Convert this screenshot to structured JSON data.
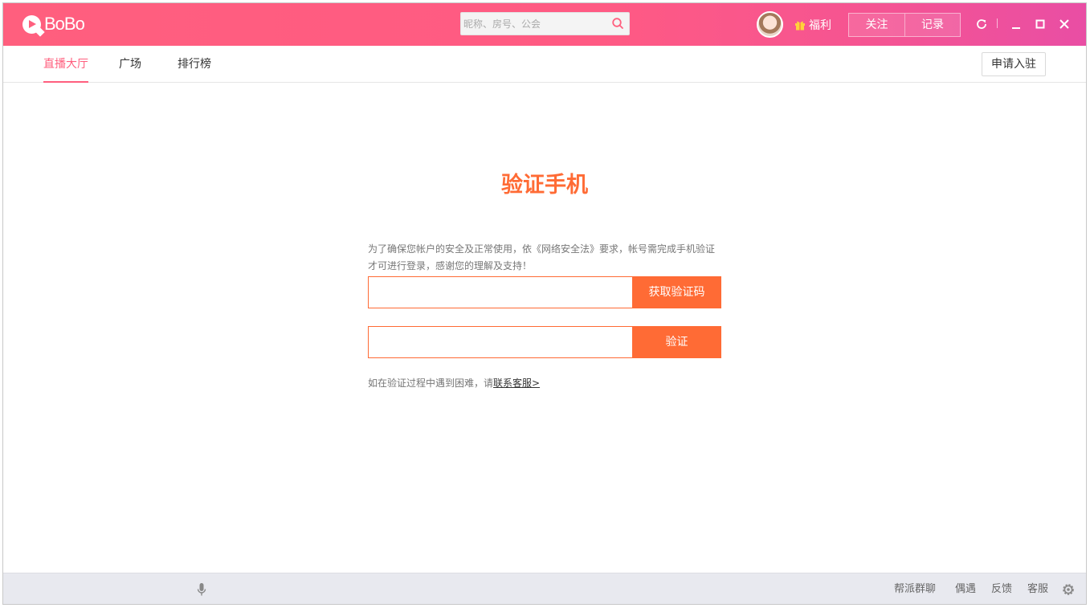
{
  "app": {
    "logo_text": "BoBo"
  },
  "header": {
    "search_placeholder": "昵称、房号、公会",
    "gift_label": "福利",
    "buttons": [
      {
        "label": "关注"
      },
      {
        "label": "记录"
      }
    ]
  },
  "tabs": [
    {
      "label": "直播大厅",
      "active": true
    },
    {
      "label": "广场",
      "active": false
    },
    {
      "label": "排行榜",
      "active": false
    }
  ],
  "apply_button": "申请入驻",
  "verify": {
    "title": "验证手机",
    "desc_line1": "为了确保您帐户的安全及正常使用，依《网络安全法》要求，帐号需完成手机验证",
    "desc_line2": "才可进行登录，感谢您的理解及支持！",
    "phone_value": "",
    "get_code_label": "获取验证码",
    "code_value": "",
    "verify_label": "验证",
    "help_text": "如在验证过程中遇到困难，请",
    "help_link": "联系客服>"
  },
  "footer": {
    "links": [
      {
        "label": "帮派群聊"
      },
      {
        "label": "偶遇"
      },
      {
        "label": "反馈"
      },
      {
        "label": "客服"
      }
    ]
  },
  "colors": {
    "brand_pink": "#ff5f7e",
    "accent_orange": "#ff6b35",
    "footer_bg": "#e8e9ef"
  },
  "icons": [
    "logo-icon",
    "search-icon",
    "avatar",
    "gift-icon",
    "refresh-icon",
    "minimize-icon",
    "maximize-icon",
    "close-icon",
    "mic-icon",
    "settings-icon"
  ]
}
